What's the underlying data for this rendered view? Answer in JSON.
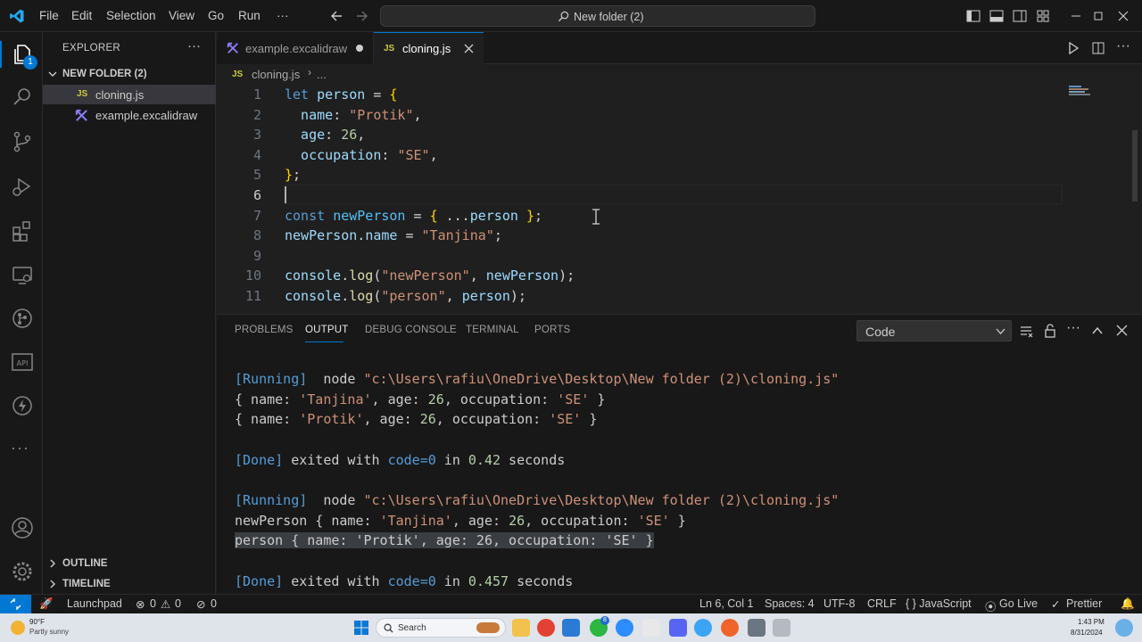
{
  "menu": [
    "File",
    "Edit",
    "Selection",
    "View",
    "Go",
    "Run",
    "···"
  ],
  "search": {
    "text": "New folder (2)"
  },
  "explorer": {
    "header": "EXPLORER",
    "folder": "NEW FOLDER (2)",
    "files": [
      {
        "badge": "JS",
        "name": "cloning.js"
      },
      {
        "name": "example.excalidraw"
      }
    ],
    "outline": "OUTLINE",
    "timeline": "TIMELINE"
  },
  "activity": {
    "badge_count": "1"
  },
  "tabs": [
    {
      "label": "example.excalidraw",
      "modified": true
    },
    {
      "badge": "JS",
      "label": "cloning.js",
      "active": true
    }
  ],
  "breadcrumb": {
    "badge": "JS",
    "file": "cloning.js",
    "rest": "..."
  },
  "code": [
    {
      "num": "1",
      "tokens": [
        [
          "k",
          "let "
        ],
        [
          "v",
          "person"
        ],
        [
          "p",
          " = "
        ],
        [
          "b",
          "{"
        ]
      ]
    },
    {
      "num": "2",
      "tokens": [
        [
          "v",
          "  name"
        ],
        [
          "p",
          ": "
        ],
        [
          "s",
          "\"Protik\""
        ],
        [
          "p",
          ","
        ]
      ]
    },
    {
      "num": "3",
      "tokens": [
        [
          "v",
          "  age"
        ],
        [
          "p",
          ": "
        ],
        [
          "n",
          "26"
        ],
        [
          "p",
          ","
        ]
      ]
    },
    {
      "num": "4",
      "tokens": [
        [
          "v",
          "  occupation"
        ],
        [
          "p",
          ": "
        ],
        [
          "s",
          "\"SE\""
        ],
        [
          "p",
          ","
        ]
      ]
    },
    {
      "num": "5",
      "tokens": [
        [
          "b",
          "}"
        ],
        [
          "p",
          ";"
        ]
      ]
    },
    {
      "num": "6",
      "tokens": []
    },
    {
      "num": "7",
      "tokens": [
        [
          "k",
          "const "
        ],
        [
          "cn",
          "newPerson"
        ],
        [
          "p",
          " = "
        ],
        [
          "b",
          "{"
        ],
        [
          "p",
          " ..."
        ],
        [
          "v",
          "person"
        ],
        [
          "p",
          " "
        ],
        [
          "b",
          "}"
        ],
        [
          "p",
          ";"
        ]
      ]
    },
    {
      "num": "8",
      "tokens": [
        [
          "v",
          "newPerson"
        ],
        [
          "p",
          "."
        ],
        [
          "v",
          "name"
        ],
        [
          "p",
          " = "
        ],
        [
          "s",
          "\"Tanjina\""
        ],
        [
          "p",
          ";"
        ]
      ]
    },
    {
      "num": "9",
      "tokens": []
    },
    {
      "num": "10",
      "tokens": [
        [
          "v",
          "console"
        ],
        [
          "p",
          "."
        ],
        [
          "f",
          "log"
        ],
        [
          "p",
          "("
        ],
        [
          "s",
          "\"newPerson\""
        ],
        [
          "p",
          ", "
        ],
        [
          "v",
          "newPerson"
        ],
        [
          "p",
          ");"
        ]
      ]
    },
    {
      "num": "11",
      "tokens": [
        [
          "v",
          "console"
        ],
        [
          "p",
          "."
        ],
        [
          "f",
          "log"
        ],
        [
          "p",
          "("
        ],
        [
          "s",
          "\"person\""
        ],
        [
          "p",
          ", "
        ],
        [
          "v",
          "person"
        ],
        [
          "p",
          ");"
        ]
      ]
    }
  ],
  "panel": {
    "tabs": [
      "PROBLEMS",
      "OUTPUT",
      "DEBUG CONSOLE",
      "TERMINAL",
      "PORTS"
    ],
    "active_tab": "OUTPUT",
    "channel": "Code",
    "lines": [
      [
        [
          "o-tag",
          "[Running]"
        ],
        [
          "",
          "  node "
        ],
        [
          "o-s",
          "\"c:\\Users\\rafiu\\OneDrive\\Desktop\\New folder (2)\\cloning.js\""
        ]
      ],
      [
        [
          "",
          "{ name: "
        ],
        [
          "o-s",
          "'Tanjina'"
        ],
        [
          "",
          ", age: "
        ],
        [
          "o-n",
          "26"
        ],
        [
          "",
          ", occupation: "
        ],
        [
          "o-s",
          "'SE'"
        ],
        [
          "",
          " }"
        ]
      ],
      [
        [
          "",
          "{ name: "
        ],
        [
          "o-s",
          "'Protik'"
        ],
        [
          "",
          ", age: "
        ],
        [
          "o-n",
          "26"
        ],
        [
          "",
          ", occupation: "
        ],
        [
          "o-s",
          "'SE'"
        ],
        [
          "",
          " }"
        ]
      ],
      [],
      [
        [
          "o-tag",
          "[Done]"
        ],
        [
          "",
          " exited with "
        ],
        [
          "o-tag",
          "code=0"
        ],
        [
          "",
          " in "
        ],
        [
          "o-n",
          "0.42"
        ],
        [
          "",
          " seconds"
        ]
      ],
      [],
      [
        [
          "o-tag",
          "[Running]"
        ],
        [
          "",
          "  node "
        ],
        [
          "o-s",
          "\"c:\\Users\\rafiu\\OneDrive\\Desktop\\New folder (2)\\cloning.js\""
        ]
      ],
      [
        [
          "",
          "newPerson { name: "
        ],
        [
          "o-s",
          "'Tanjina'"
        ],
        [
          "",
          ", age: "
        ],
        [
          "o-n",
          "26"
        ],
        [
          "",
          ", occupation: "
        ],
        [
          "o-s",
          "'SE'"
        ],
        [
          "",
          " }"
        ]
      ],
      [
        [
          "o-sel",
          "person { name: 'Protik', age: 26, occupation: 'SE' }"
        ]
      ],
      [],
      [
        [
          "o-tag",
          "[Done]"
        ],
        [
          "",
          " exited with "
        ],
        [
          "o-tag",
          "code=0"
        ],
        [
          "",
          " in "
        ],
        [
          "o-n",
          "0.457"
        ],
        [
          "",
          " seconds"
        ]
      ]
    ]
  },
  "status": {
    "launchpad": "Launchpad",
    "errors": "0",
    "warnings": "0",
    "ports": "0",
    "position": "Ln 6, Col 1",
    "spaces": "Spaces: 4",
    "encoding": "UTF-8",
    "eol": "CRLF",
    "language": "{ } JavaScript",
    "golive": "Go Live",
    "prettier": "Prettier"
  },
  "taskbar": {
    "weather_temp": "90°F",
    "weather_desc": "Partly sunny",
    "search": "Search",
    "time": "1:43 PM",
    "date": "8/31/2024",
    "vscode_badge": "8"
  },
  "colors": {
    "accent": "#0078d4",
    "editor_bg": "#1f1f1f",
    "chrome_bg": "#181818"
  }
}
